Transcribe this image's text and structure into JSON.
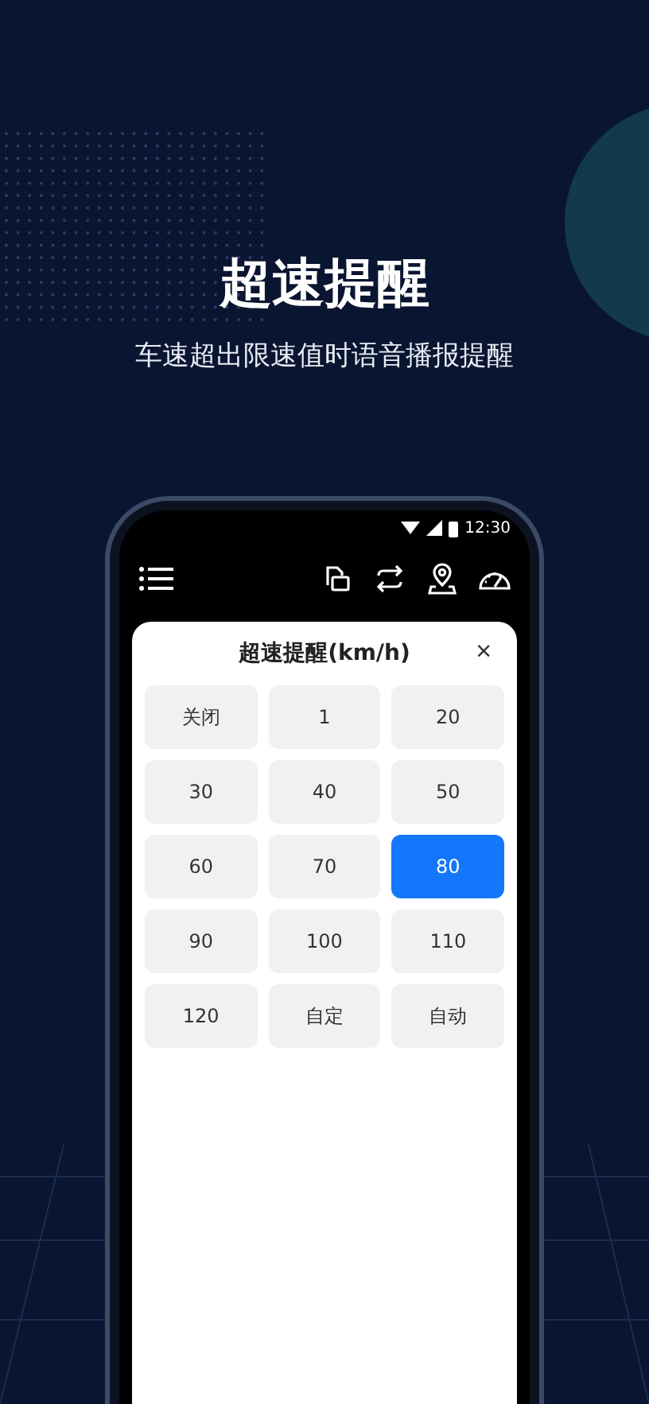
{
  "headline": "超速提醒",
  "subtitle": "车速超出限速值时语音播报提醒",
  "status_bar": {
    "time": "12:30"
  },
  "dialog": {
    "title": "超速提醒(km/h)",
    "close": "×",
    "options": [
      {
        "label": "关闭",
        "selected": false
      },
      {
        "label": "1",
        "selected": false
      },
      {
        "label": "20",
        "selected": false
      },
      {
        "label": "30",
        "selected": false
      },
      {
        "label": "40",
        "selected": false
      },
      {
        "label": "50",
        "selected": false
      },
      {
        "label": "60",
        "selected": false
      },
      {
        "label": "70",
        "selected": false
      },
      {
        "label": "80",
        "selected": true
      },
      {
        "label": "90",
        "selected": false
      },
      {
        "label": "100",
        "selected": false
      },
      {
        "label": "110",
        "selected": false
      },
      {
        "label": "120",
        "selected": false
      },
      {
        "label": "自定",
        "selected": false
      },
      {
        "label": "自动",
        "selected": false
      }
    ]
  }
}
